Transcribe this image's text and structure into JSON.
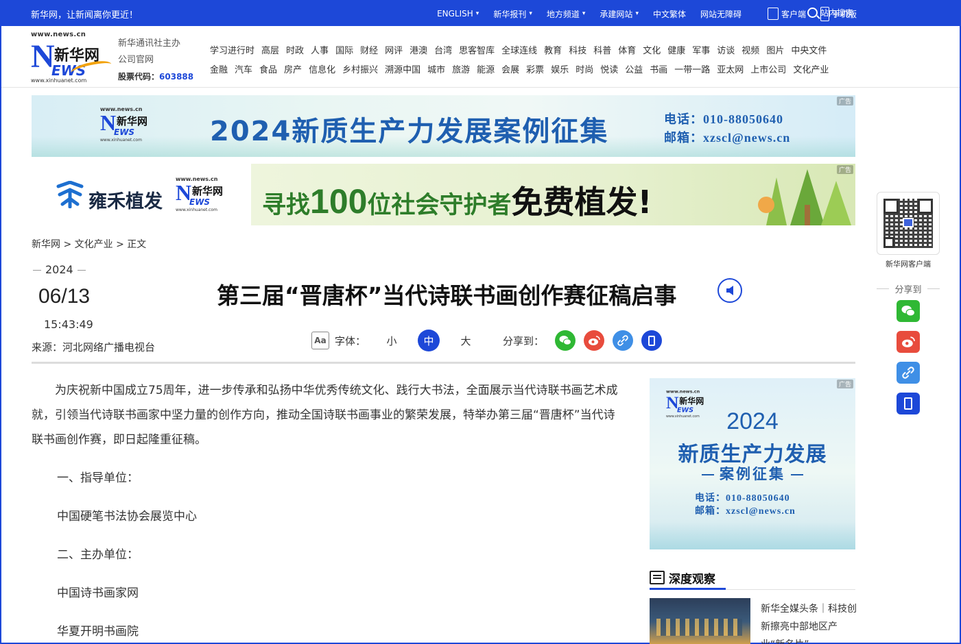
{
  "topbar": {
    "slogan": "新华网，让新闻离你更近！",
    "nav": [
      {
        "label": "ENGLISH",
        "caret": true
      },
      {
        "label": "新华报刊",
        "caret": true
      },
      {
        "label": "地方频道",
        "caret": true
      },
      {
        "label": "承建网站",
        "caret": true
      },
      {
        "label": "中文繁体",
        "caret": false
      },
      {
        "label": "网站无障碍",
        "caret": false
      }
    ],
    "client_label": "客户端",
    "mobile_label": "手机版",
    "search_label": "站内搜索",
    "caret_glyph": "⌄"
  },
  "logo": {
    "url_top": "www.news.cn",
    "letter_n": "N",
    "cn": "新华网",
    "ews": "EWS",
    "url_bottom": "www.xinhuanet.com"
  },
  "corp": {
    "line1": "新华通讯社主办",
    "line2": "公司官网",
    "code_label": "股票代码：",
    "code": "603888"
  },
  "channels": {
    "row1": [
      "学习进行时",
      "高层",
      "时政",
      "人事",
      "国际",
      "财经",
      "网评",
      "港澳",
      "台湾",
      "思客智库",
      "全球连线",
      "教育",
      "科技",
      "科普",
      "体育",
      "文化",
      "健康",
      "军事",
      "访谈",
      "视频",
      "图片",
      "中央文件"
    ],
    "row2": [
      "金融",
      "汽车",
      "食品",
      "房产",
      "信息化",
      "乡村振兴",
      "溯源中国",
      "城市",
      "旅游",
      "能源",
      "会展",
      "彩票",
      "娱乐",
      "时尚",
      "悦读",
      "公益",
      "书画",
      "一带一路",
      "亚太网",
      "上市公司",
      "文化产业"
    ]
  },
  "ads": {
    "tag": "广告",
    "ad1": {
      "title": "2024新质生产力发展案例征集",
      "phone": "电话：010-88050640",
      "email": "邮箱：xzscl@news.cn"
    },
    "ad2": {
      "brand": "雍禾植发",
      "slogan_a": "寻找",
      "slogan_num": "100",
      "slogan_b": "位社会守护者",
      "slogan_free": "免费植发!"
    },
    "side": {
      "year": "2024",
      "line1": "新质生产力发展",
      "line2": "案例征集",
      "phone": "电话：010-88050640",
      "email": "邮箱：xzscl@news.cn"
    }
  },
  "breadcrumb": "新华网 > 文化产业 > 正文",
  "meta": {
    "year": "2024",
    "month_day": "06/13",
    "time": "15:43:49",
    "source": "来源：河北网络广播电视台"
  },
  "headline": "第三届“晋唐杯”当代诗联书画创作赛征稿启事",
  "tools": {
    "aa": "Aa",
    "font_label": "字体：",
    "sizes": [
      "小",
      "中",
      "大"
    ],
    "share_label": "分享到："
  },
  "article": {
    "intro": "为庆祝新中国成立75周年，进一步传承和弘扬中华优秀传统文化、践行大书法，全面展示当代诗联书画艺术成就，引领当代诗联书画家中坚力量的创作方向，推动全国诗联书画事业的繁荣发展，特举办第三届“晋唐杯”当代诗联书画创作赛，即日起隆重征稿。",
    "s1_title": "一、指导单位：",
    "s1_body": "中国硬笔书法协会展览中心",
    "s2_title": "二、主办单位：",
    "s2_body1": "中国诗书画家网",
    "s2_body2": "华夏开明书画院"
  },
  "deep": {
    "title": "深度观察",
    "item_text": "新华全媒头条｜科技创新擦亮中部地区产业“新名片”"
  },
  "float": {
    "caption": "新华网客户端",
    "share_label": "分享到"
  },
  "colors": {
    "brand_blue": "#1d48d8",
    "wechat_green": "#2fb834",
    "weibo_red": "#e84c3d",
    "link_blue": "#3f8fe6"
  },
  "icons": [
    "app-icon",
    "phone-icon",
    "search-icon",
    "speaker-icon",
    "wechat-icon",
    "weibo-icon",
    "link-icon",
    "mobile-icon",
    "book-icon",
    "qr-code"
  ]
}
